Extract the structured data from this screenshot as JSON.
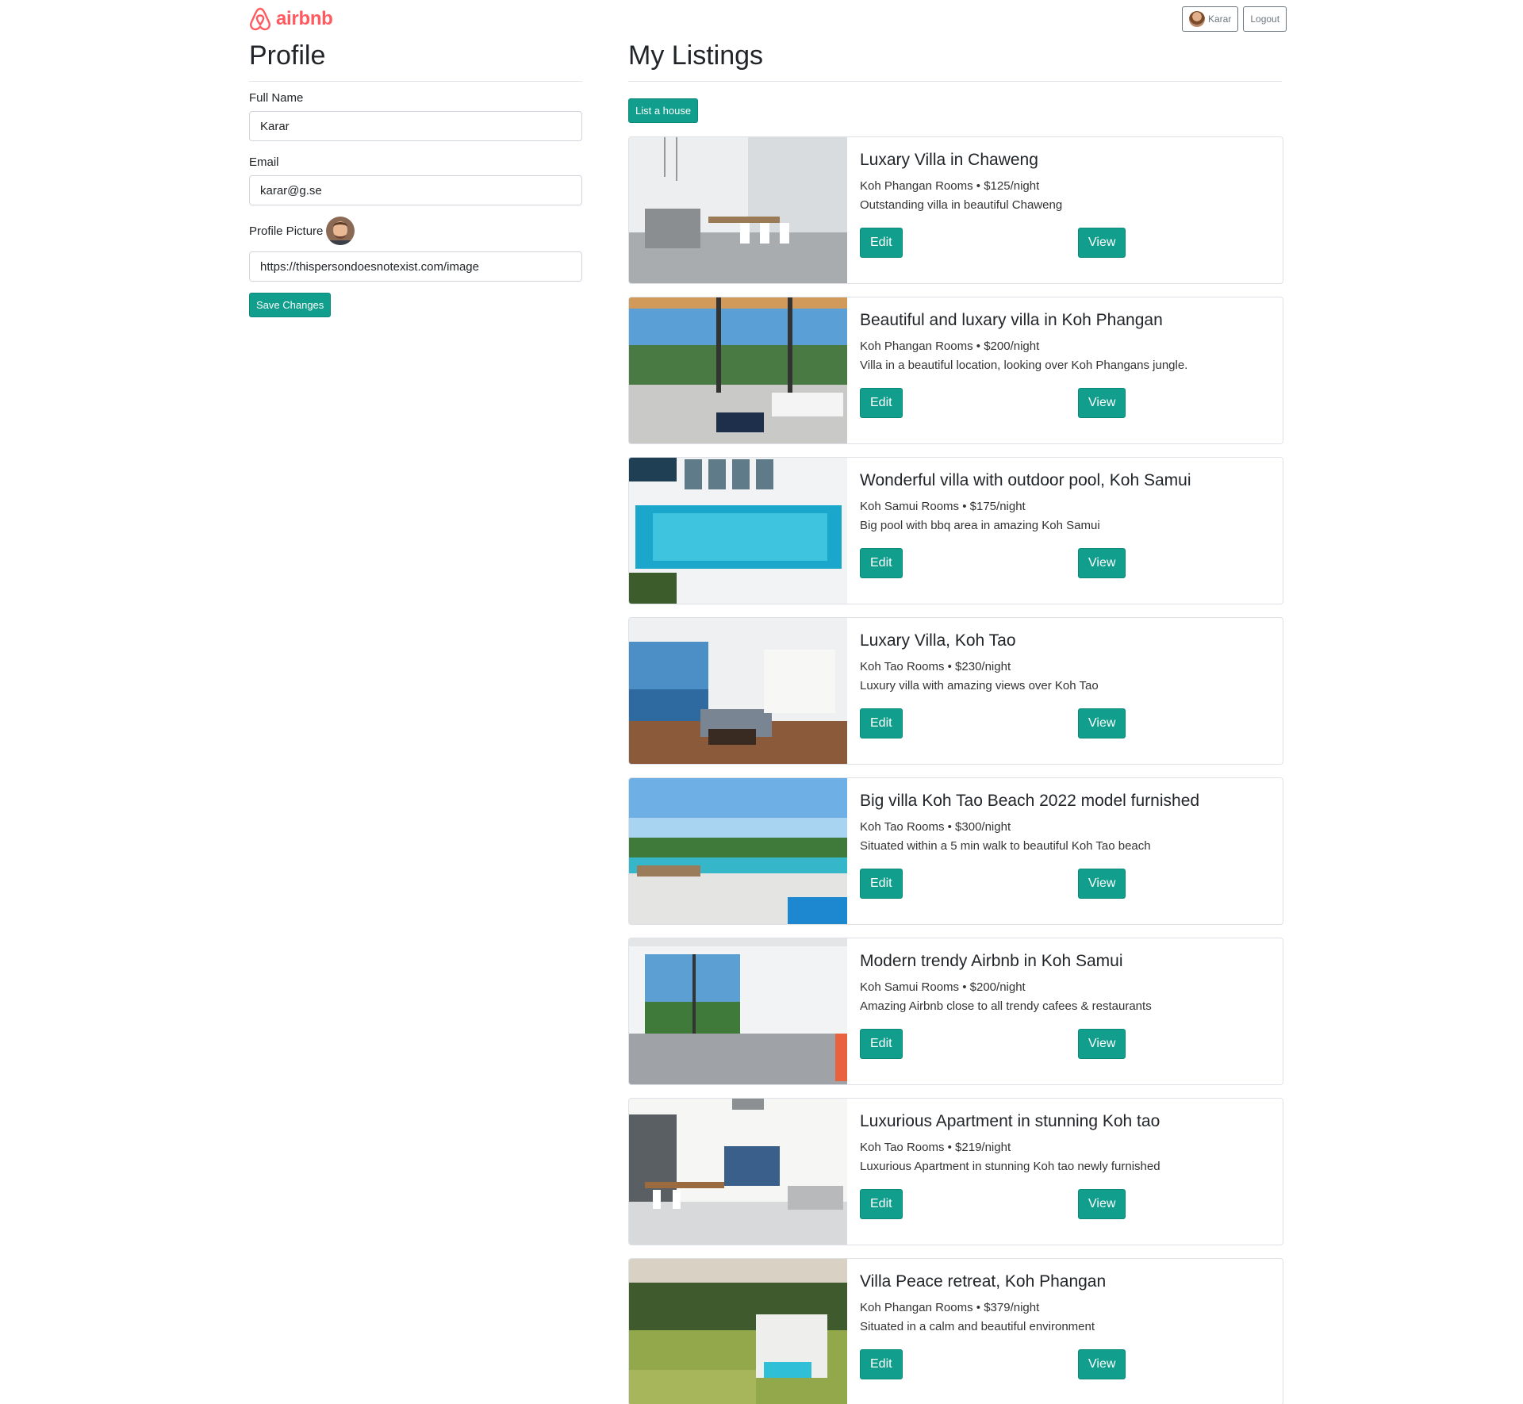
{
  "brand": {
    "name": "airbnb",
    "color": "#ff5a5f",
    "icon": "airbnb-logo-icon"
  },
  "header": {
    "user_button_label": "Karar",
    "logout_label": "Logout"
  },
  "profile": {
    "title": "Profile",
    "full_name_label": "Full Name",
    "full_name_value": "Karar",
    "email_label": "Email",
    "email_value": "karar@g.se",
    "picture_label": "Profile Picture",
    "picture_url_value": "https://thispersondoesnotexist.com/image",
    "save_label": "Save Changes"
  },
  "listings": {
    "title": "My Listings",
    "add_label": "List a house",
    "accent": "#119e8c",
    "items": [
      {
        "title": "Luxary Villa in Chaweng",
        "location": "Koh Phangan Rooms",
        "price": "$125/night",
        "description": "Outstanding villa in beautiful Chaweng",
        "edit_label": "Edit",
        "view_label": "View"
      },
      {
        "title": "Beautiful and luxary villa in Koh Phangan",
        "location": "Koh Phangan Rooms",
        "price": "$200/night",
        "description": "Villa in a beautiful location, looking over Koh Phangans jungle.",
        "edit_label": "Edit",
        "view_label": "View"
      },
      {
        "title": "Wonderful villa with outdoor pool, Koh Samui",
        "location": "Koh Samui Rooms",
        "price": "$175/night",
        "description": "Big pool with bbq area in amazing Koh Samui",
        "edit_label": "Edit",
        "view_label": "View"
      },
      {
        "title": "Luxary Villa, Koh Tao",
        "location": "Koh Tao Rooms",
        "price": "$230/night",
        "description": "Luxury villa with amazing views over Koh Tao",
        "edit_label": "Edit",
        "view_label": "View"
      },
      {
        "title": "Big villa Koh Tao Beach 2022 model furnished",
        "location": "Koh Tao Rooms",
        "price": "$300/night",
        "description": "Situated within a 5 min walk to beautiful Koh Tao beach",
        "edit_label": "Edit",
        "view_label": "View"
      },
      {
        "title": "Modern trendy Airbnb in Koh Samui",
        "location": "Koh Samui Rooms",
        "price": "$200/night",
        "description": "Amazing Airbnb close to all trendy cafees & restaurants",
        "edit_label": "Edit",
        "view_label": "View"
      },
      {
        "title": "Luxurious Apartment in stunning Koh tao",
        "location": "Koh Tao Rooms",
        "price": "$219/night",
        "description": "Luxurious Apartment in stunning Koh tao newly furnished",
        "edit_label": "Edit",
        "view_label": "View"
      },
      {
        "title": "Villa Peace retreat, Koh Phangan",
        "location": "Koh Phangan Rooms",
        "price": "$379/night",
        "description": "Situated in a calm and beautiful environment",
        "edit_label": "Edit",
        "view_label": "View"
      }
    ]
  }
}
